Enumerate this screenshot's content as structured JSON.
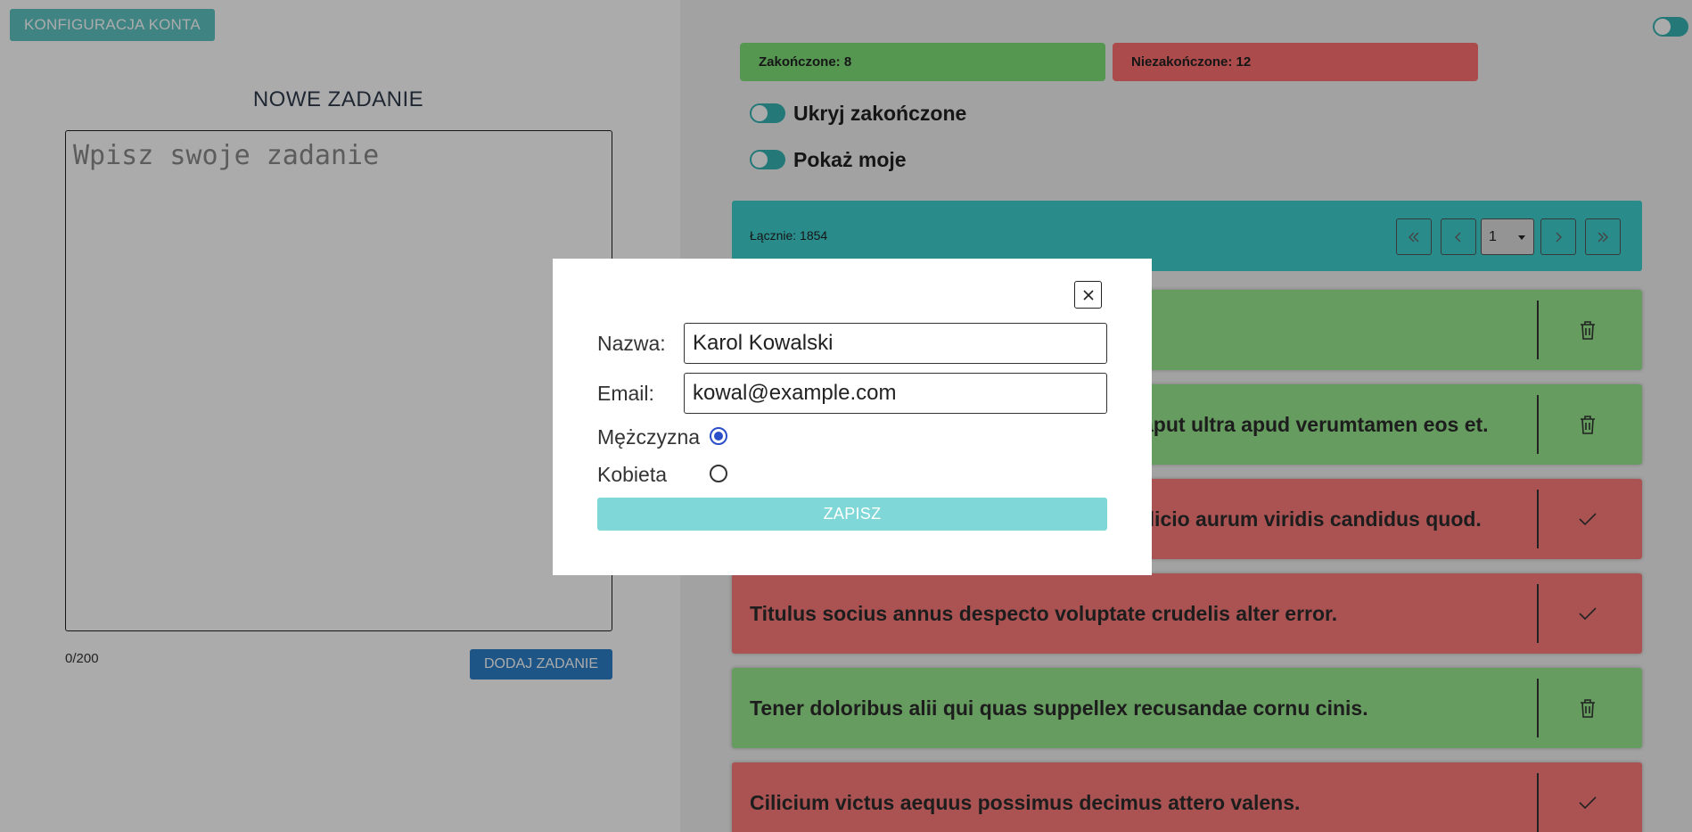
{
  "left": {
    "config_button": "KONFIGURACJA KONTA",
    "new_task_title": "NOWE ZADANIE",
    "textarea_placeholder": "Wpisz swoje zadanie",
    "textarea_value": "",
    "char_counter": "0/200",
    "add_button": "DODAJ ZADANIE"
  },
  "right": {
    "stats": {
      "done": "Zakończone: 8",
      "undone": "Niezakończone: 12"
    },
    "toggles": {
      "hide_done": "Ukryj zakończone",
      "show_mine": "Pokaż moje"
    },
    "total": "Łącznie: 1854",
    "pagination": {
      "first_icon": "double-chevron-left-icon",
      "prev_icon": "chevron-left-icon",
      "page": "1",
      "next_icon": "chevron-right-icon",
      "last_icon": "double-chevron-right-icon"
    },
    "tasks": [
      {
        "text": "",
        "status": "done",
        "action_icon": "trash-icon"
      },
      {
        "text": "aput ultra apud verumtamen eos et.",
        "status": "done",
        "action_icon": "trash-icon"
      },
      {
        "text": "dicio aurum viridis candidus quod.",
        "status": "undone",
        "action_icon": "check-icon"
      },
      {
        "text": "Titulus socius annus despecto voluptate crudelis alter error.",
        "status": "undone",
        "action_icon": "check-icon"
      },
      {
        "text": "Tener doloribus alii qui quas suppellex recusandae cornu cinis.",
        "status": "done",
        "action_icon": "trash-icon"
      },
      {
        "text": "Cilicium victus aequus possimus decimus attero valens.",
        "status": "undone",
        "action_icon": "check-icon"
      }
    ]
  },
  "modal": {
    "name_label": "Nazwa:",
    "name_value": "Karol Kowalski",
    "email_label": "Email:",
    "email_value": "kowal@example.com",
    "gender_male": "Mężczyzna",
    "gender_female": "Kobieta",
    "selected_gender": "male",
    "save_button": "ZAPISZ"
  },
  "colors": {
    "teal": "#37b3b3",
    "done_green": "#98e98e",
    "undone_red": "#ff7c7c",
    "add_blue": "#2b7fc8"
  }
}
